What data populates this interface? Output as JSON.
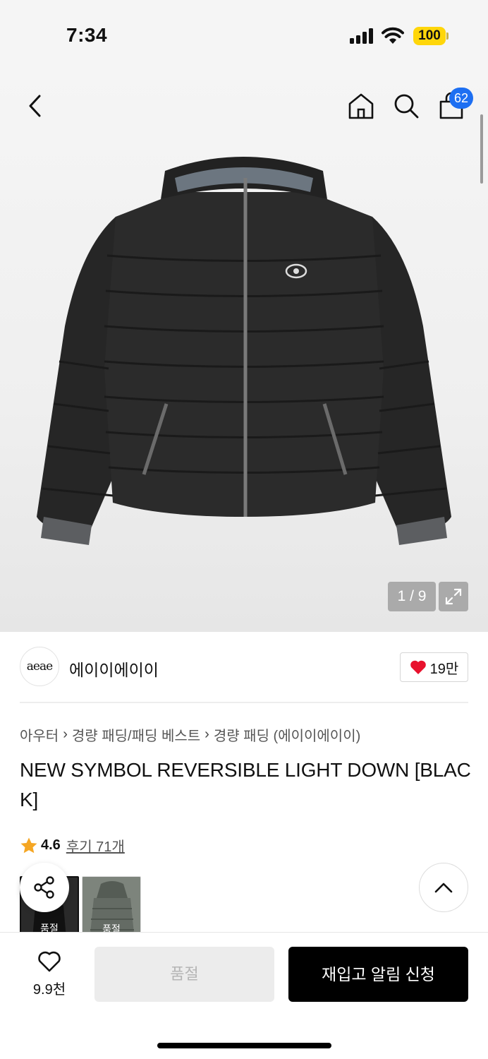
{
  "status_bar": {
    "time": "7:34",
    "battery": "100",
    "icons": [
      "signal-icon",
      "wifi-icon",
      "battery-icon"
    ]
  },
  "header": {
    "icons": [
      "back-icon",
      "home-icon",
      "search-icon",
      "cart-icon"
    ],
    "cart_count": "62"
  },
  "gallery": {
    "pager": "1 / 9",
    "icons": [
      "expand-icon"
    ]
  },
  "brand": {
    "logo_text": "aeae",
    "name": "에이이에이이",
    "likes": "19만",
    "like_color": "#e8112d"
  },
  "breadcrumb": [
    "아우터",
    "경량 패딩/패딩 베스트",
    "경량 패딩 (에이이에이이)"
  ],
  "product": {
    "title": "NEW SYMBOL REVERSIBLE LIGHT DOWN [BLACK]",
    "rating": "4.6",
    "reviews": "후기 71개",
    "star_color": "#f5a623"
  },
  "options": [
    {
      "label": "품절"
    },
    {
      "label": "품절"
    }
  ],
  "bottom_bar": {
    "wish_count": "9.9천",
    "soldout_label": "품절",
    "restock_label": "재입고 알림 신청"
  }
}
